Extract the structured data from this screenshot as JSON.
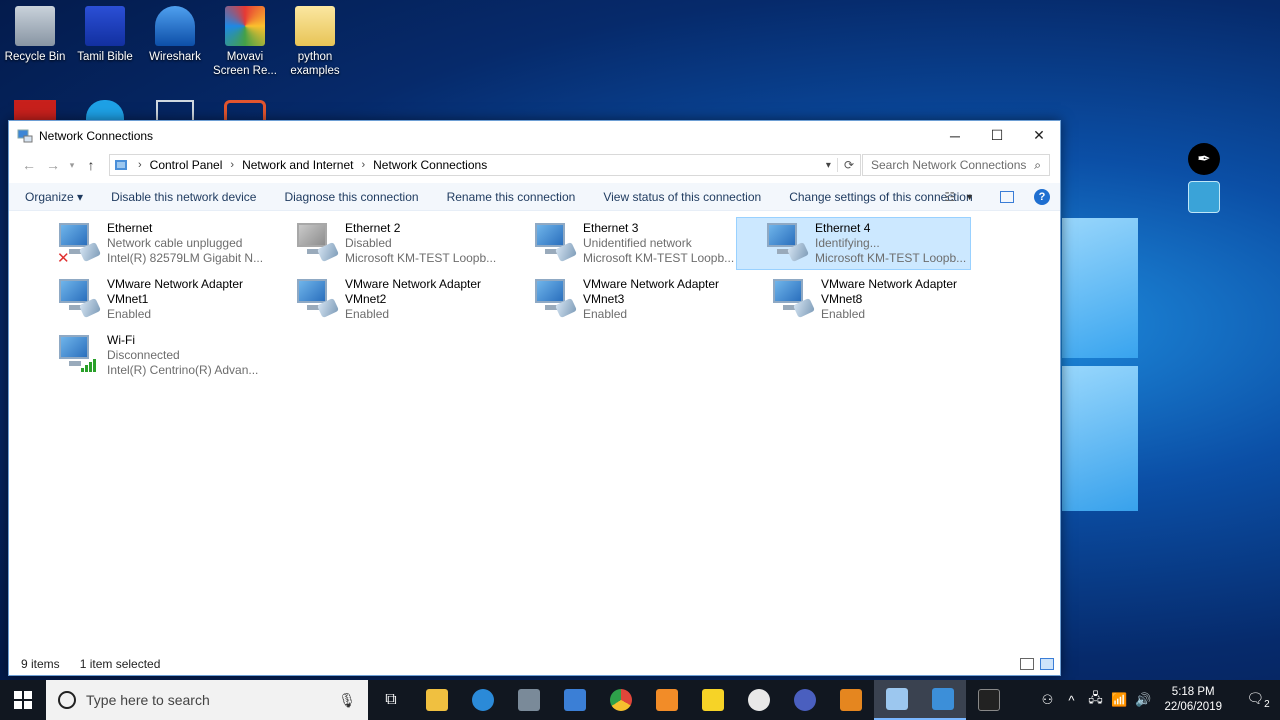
{
  "desktop": {
    "icons": [
      {
        "label": "Recycle Bin",
        "color": "#9aa7b3"
      },
      {
        "label": "Tamil Bible",
        "color": "#1d3fbf"
      },
      {
        "label": "Wireshark",
        "color": "#1565c0"
      },
      {
        "label": "Movavi Screen Re...",
        "color": "#d94b3b"
      },
      {
        "label": "python examples",
        "color": "#f2d36b"
      }
    ]
  },
  "window": {
    "title": "Network Connections",
    "controls": {
      "minimize": "─",
      "maximize": "☐",
      "close": "✕"
    },
    "breadcrumb": [
      "Control Panel",
      "Network and Internet",
      "Network Connections"
    ],
    "search_placeholder": "Search Network Connections",
    "toolbar": {
      "organize": "Organize ▾",
      "disable": "Disable this network device",
      "diagnose": "Diagnose this connection",
      "rename": "Rename this connection",
      "view_status": "View status of this connection",
      "change_settings": "Change settings of this connection",
      "help": "?"
    },
    "connections": [
      {
        "name": "Ethernet",
        "status": "Network cable unplugged",
        "device": "Intel(R) 82579LM Gigabit N...",
        "icon": "ethernet-disconnected-icon"
      },
      {
        "name": "Ethernet 2",
        "status": "Disabled",
        "device": "Microsoft KM-TEST Loopb...",
        "icon": "ethernet-disabled-icon"
      },
      {
        "name": "Ethernet 3",
        "status": "Unidentified network",
        "device": "Microsoft KM-TEST Loopb...",
        "icon": "ethernet-icon"
      },
      {
        "name": "Ethernet 4",
        "status": "Identifying...",
        "device": "Microsoft KM-TEST Loopb...",
        "icon": "ethernet-icon",
        "selected": true
      },
      {
        "name": "VMware Network Adapter",
        "name2": "VMnet1",
        "status": "Enabled",
        "icon": "vmware-adapter-icon"
      },
      {
        "name": "VMware Network Adapter",
        "name2": "VMnet2",
        "status": "Enabled",
        "icon": "vmware-adapter-icon"
      },
      {
        "name": "VMware Network Adapter",
        "name2": "VMnet3",
        "status": "Enabled",
        "icon": "vmware-adapter-icon"
      },
      {
        "name": "VMware Network Adapter",
        "name2": "VMnet8",
        "status": "Enabled",
        "icon": "vmware-adapter-icon"
      },
      {
        "name": "Wi-Fi",
        "status": "Disconnected",
        "device": "Intel(R) Centrino(R) Advan...",
        "icon": "wifi-icon"
      }
    ],
    "status": {
      "count": "9 items",
      "selected": "1 item selected"
    }
  },
  "taskbar": {
    "search_placeholder": "Type here to search",
    "clock_time": "5:18 PM",
    "clock_date": "22/06/2019",
    "apps": [
      {
        "name": "task-view-icon",
        "color": "#ffffff"
      },
      {
        "name": "file-explorer-icon",
        "color": "#f0c040"
      },
      {
        "name": "edge-icon",
        "color": "#2b8ad8"
      },
      {
        "name": "photos-icon",
        "color": "#7a8a99"
      },
      {
        "name": "vs-icon",
        "color": "#3b7fd6"
      },
      {
        "name": "chrome-icon",
        "color": "#e0463a"
      },
      {
        "name": "sublime-icon",
        "color": "#f28c28"
      },
      {
        "name": "sticky-notes-icon",
        "color": "#f6d327"
      },
      {
        "name": "inkscape-icon",
        "color": "#e8e8e8"
      },
      {
        "name": "eclipse-icon",
        "color": "#4a5fbf"
      },
      {
        "name": "virtualbox-icon",
        "color": "#e5861f"
      },
      {
        "name": "network-app-icon",
        "color": "#9cc7ef"
      },
      {
        "name": "control-panel-icon",
        "color": "#3c8fd9"
      },
      {
        "name": "cmd-icon",
        "color": "#222222"
      }
    ],
    "tray": [
      "⚇",
      "^",
      "🖧",
      "📶",
      "🔊"
    ],
    "notification_count": "2"
  }
}
